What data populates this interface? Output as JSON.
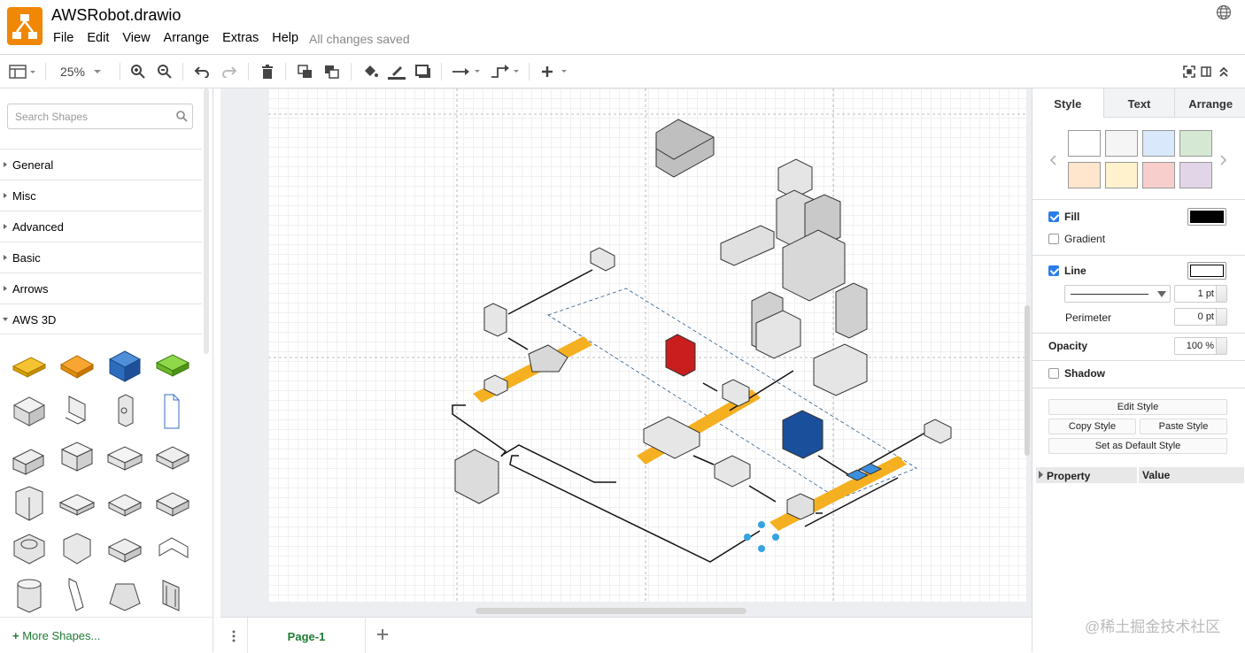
{
  "app": {
    "title": "AWSRobot.drawio",
    "saved_status": "All changes saved"
  },
  "menu": [
    "File",
    "Edit",
    "View",
    "Arrange",
    "Extras",
    "Help"
  ],
  "toolbar": {
    "zoom": "25%",
    "icons": [
      "sidebar-toggle-icon",
      "zoom-in-icon",
      "zoom-out-icon",
      "undo-icon",
      "redo-icon",
      "delete-icon",
      "to-front-icon",
      "to-back-icon",
      "fill-color-icon",
      "line-color-icon",
      "shadow-icon",
      "connection-icon",
      "waypoints-icon",
      "insert-icon",
      "fullscreen-icon",
      "format-panel-icon",
      "collapse-icon"
    ]
  },
  "sidebar": {
    "search_placeholder": "Search Shapes",
    "categories": [
      {
        "label": "General",
        "open": false
      },
      {
        "label": "Misc",
        "open": false
      },
      {
        "label": "Advanced",
        "open": false
      },
      {
        "label": "Basic",
        "open": false
      },
      {
        "label": "Arrows",
        "open": false
      },
      {
        "label": "AWS 3D",
        "open": true
      }
    ],
    "more_shapes": "More Shapes..."
  },
  "footer": {
    "page_tab": "Page-1"
  },
  "format": {
    "tabs": [
      "Style",
      "Text",
      "Arrange"
    ],
    "swatches": [
      "#ffffff",
      "#f5f5f5",
      "#dae8fc",
      "#d5e8d4",
      "#ffe6cc",
      "#fff2cc",
      "#f8cecc",
      "#e1d5e7"
    ],
    "fill_label": "Fill",
    "fill_color": "#000000",
    "gradient_label": "Gradient",
    "line_label": "Line",
    "line_width": "1 pt",
    "perimeter_label": "Perimeter",
    "perimeter_value": "0 pt",
    "opacity_label": "Opacity",
    "opacity_value": "100 %",
    "shadow_label": "Shadow",
    "edit_style": "Edit Style",
    "copy_style": "Copy Style",
    "paste_style": "Paste Style",
    "set_default": "Set as Default Style",
    "property_header": "Property",
    "value_header": "Value"
  },
  "watermark": "@稀土掘金技术社区"
}
